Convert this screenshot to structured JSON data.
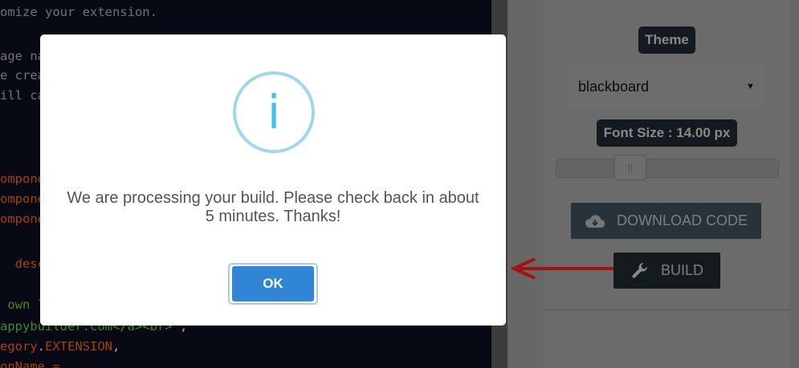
{
  "editor": {
    "lines": [
      {
        "spans": [
          {
            "t": "omize your extension.",
            "c": "c-comment"
          }
        ]
      },
      {
        "spans": [
          {
            "t": "",
            "c": "c-comment"
          }
        ]
      },
      {
        "spans": [
          {
            "t": "age na",
            "c": "c-comment"
          }
        ]
      },
      {
        "spans": [
          {
            "t": "e crea",
            "c": "c-comment"
          }
        ]
      },
      {
        "spans": [
          {
            "t": "ill ca",
            "c": "c-comment"
          }
        ]
      },
      {
        "spans": [
          {
            "t": "",
            "c": "c-comment"
          }
        ]
      },
      {
        "spans": [
          {
            "t": "",
            "c": "c-comment"
          }
        ]
      },
      {
        "spans": [
          {
            "t": "",
            "c": "c-comment"
          }
        ]
      },
      {
        "spans": [
          {
            "t": "ompone",
            "c": "c-ident"
          }
        ]
      },
      {
        "spans": [
          {
            "t": "ompone",
            "c": "c-ident"
          }
        ]
      },
      {
        "spans": [
          {
            "t": "ompone",
            "c": "c-ident"
          }
        ]
      },
      {
        "spans": [
          {
            "t": "",
            "c": "c-comment"
          }
        ]
      },
      {
        "spans": [
          {
            "t": "  desc",
            "c": "c-ident"
          }
        ]
      },
      {
        "spans": [
          {
            "t": "",
            "c": "c-comment"
          }
        ]
      },
      {
        "spans": [
          {
            "t": " own l",
            "c": "c-green"
          }
        ]
      },
      {
        "spans": [
          {
            "t": "appybuilder.com</a><br>",
            "c": "c-green"
          },
          {
            "t": "\",",
            "c": "c-white"
          }
        ]
      },
      {
        "spans": [
          {
            "t": "egory",
            "c": "c-ident"
          },
          {
            "t": ".",
            "c": "c-white"
          },
          {
            "t": "EXTENSION",
            "c": "c-ident"
          },
          {
            "t": ",",
            "c": "c-white"
          }
        ]
      },
      {
        "spans": [
          {
            "t": "onName =",
            "c": "c-ident"
          }
        ]
      }
    ]
  },
  "settings": {
    "theme_label": "Theme",
    "theme_value": "blackboard",
    "font_size_label": "Font Size : 14.00 px",
    "download_label": "DOWNLOAD CODE",
    "build_label": "BUILD"
  },
  "modal": {
    "message_line1": "We are processing your build. Please check back in about",
    "message_line2": "5 minutes. Thanks!",
    "info_glyph": "i",
    "ok_label": "OK"
  },
  "colors": {
    "accent": "#3085d6",
    "info": "#3fc3ee",
    "arrow": "#ff1a1a"
  },
  "icons": [
    "info-icon",
    "cloud-download-icon",
    "wrench-icon",
    "red-arrow-icon",
    "dropdown-arrow-icon"
  ]
}
